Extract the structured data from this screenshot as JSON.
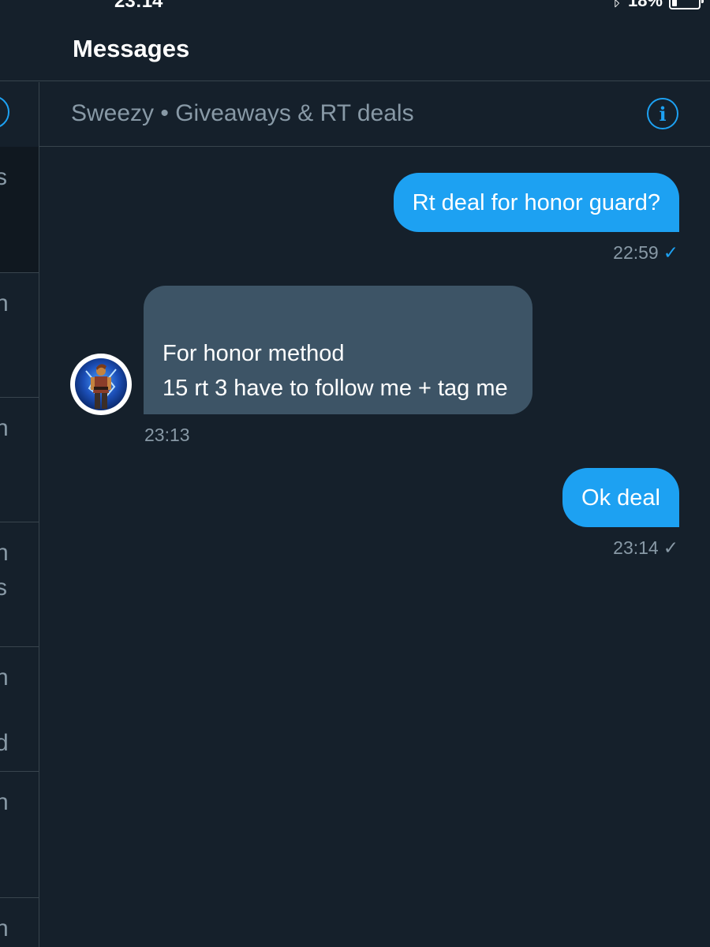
{
  "status_bar": {
    "time": "23:14",
    "battery_percent": "18%",
    "battery_level": 0.18,
    "bluetooth_icon": "bluetooth-icon"
  },
  "header": {
    "title": "Messages"
  },
  "sidebar": {
    "items": [
      {
        "lines": [
          "s"
        ]
      },
      {
        "lines": [
          "n"
        ]
      },
      {
        "lines": [
          "n"
        ]
      },
      {
        "lines": [
          "n",
          "s"
        ]
      },
      {
        "lines": [
          "n",
          "d"
        ]
      },
      {
        "lines": [
          "n"
        ]
      },
      {
        "lines": [
          "n"
        ]
      }
    ]
  },
  "conversation": {
    "title": "Sweezy • Giveaways & RT deals",
    "info_icon": "info-icon",
    "messages": [
      {
        "direction": "out",
        "text": "Rt deal for honor guard?",
        "time": "22:59",
        "status": "✓",
        "status_color": "#1da1f2"
      },
      {
        "direction": "in",
        "text": "For honor method\n15 rt 3 have to follow me + tag me",
        "time": "23:13"
      },
      {
        "direction": "out",
        "text": "Ok deal",
        "time": "23:14",
        "status": "✓",
        "status_color": "#8899a6"
      }
    ]
  },
  "colors": {
    "background": "#15202b",
    "accent": "#1da1f2",
    "incoming_bubble": "#3d5466",
    "muted_text": "#8899a6",
    "divider": "#38444d"
  }
}
